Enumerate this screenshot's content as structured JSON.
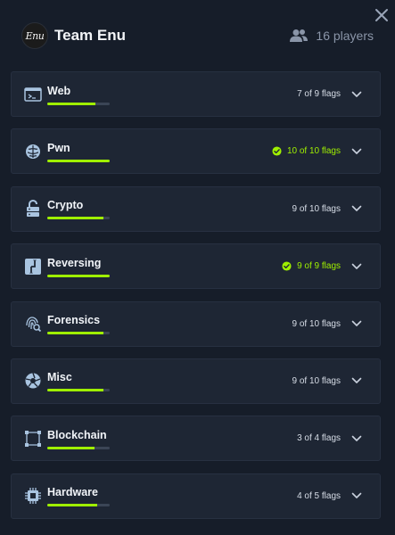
{
  "header": {
    "logo_text": "Enu",
    "team_name": "Team Enu",
    "players_label": "16 players"
  },
  "colors": {
    "accent": "#9fef00",
    "background": "#161d29",
    "card": "#1e2634",
    "muted": "#8a95a8"
  },
  "categories": [
    {
      "name": "Web",
      "icon": "terminal-window-icon",
      "solved": 7,
      "total": 9,
      "flags_label": "7 of 9 flags",
      "complete": false
    },
    {
      "name": "Pwn",
      "icon": "brain-icon",
      "solved": 10,
      "total": 10,
      "flags_label": "10 of 10 flags",
      "complete": true
    },
    {
      "name": "Crypto",
      "icon": "unlock-server-icon",
      "solved": 9,
      "total": 10,
      "flags_label": "9 of 10 flags",
      "complete": false
    },
    {
      "name": "Reversing",
      "icon": "reverse-arrows-icon",
      "solved": 9,
      "total": 9,
      "flags_label": "9 of 9 flags",
      "complete": true
    },
    {
      "name": "Forensics",
      "icon": "fingerprint-search-icon",
      "solved": 9,
      "total": 10,
      "flags_label": "9 of 10 flags",
      "complete": false
    },
    {
      "name": "Misc",
      "icon": "aperture-icon",
      "solved": 9,
      "total": 10,
      "flags_label": "9 of 10 flags",
      "complete": false
    },
    {
      "name": "Blockchain",
      "icon": "blockchain-nodes-icon",
      "solved": 3,
      "total": 4,
      "flags_label": "3 of 4 flags",
      "complete": false
    },
    {
      "name": "Hardware",
      "icon": "chip-icon",
      "solved": 4,
      "total": 5,
      "flags_label": "4 of 5 flags",
      "complete": false
    }
  ]
}
